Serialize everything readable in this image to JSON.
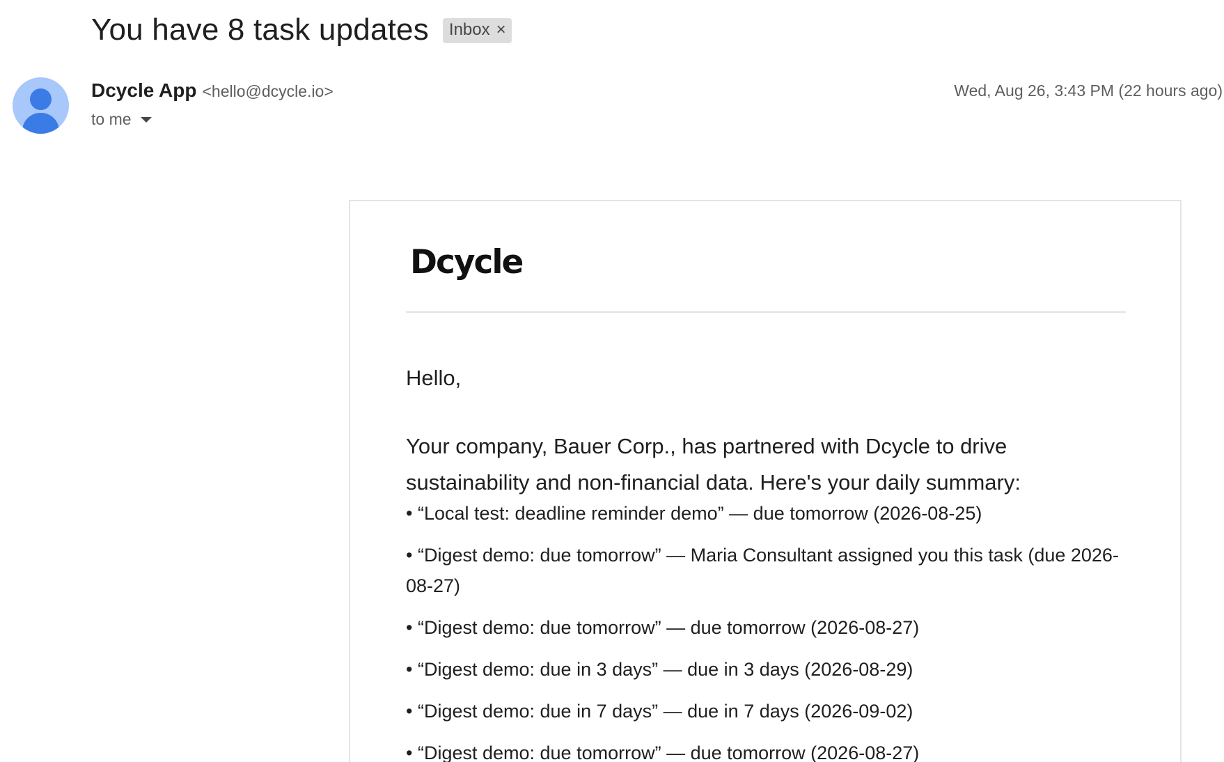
{
  "subject": "You have 8 task updates",
  "label": {
    "name": "Inbox",
    "close_glyph": "×"
  },
  "sender": {
    "name": "Dcycle App",
    "email": "<hello@dcycle.io>",
    "recipient": "to me",
    "date": "Wed, Aug 26, 3:43 PM (22 hours ago)",
    "avatar_icon": "person-icon"
  },
  "body": {
    "logo_text": "Dcycle",
    "greeting": "Hello,",
    "intro": "Your company, Bauer Corp., has partnered with Dcycle to drive sustainability and non-financial data. Here's your daily summary:",
    "tasks": [
      "• “Local test: deadline reminder demo” — due tomorrow (2026-08-25)",
      "• “Digest demo: due tomorrow” — Maria Consultant assigned you this task (due 2026-08-27)",
      "• “Digest demo: due tomorrow” — due tomorrow (2026-08-27)",
      "• “Digest demo: due in 3 days” — due in 3 days (2026-08-29)",
      "• “Digest demo: due in 7 days” — due in 7 days (2026-09-02)",
      "• “Digest demo: due tomorrow” — due tomorrow (2026-08-27)"
    ]
  },
  "colors": {
    "avatar_bg": "#a8c7fa",
    "avatar_fg": "#3b7be5",
    "chip_bg": "#dddddd"
  }
}
